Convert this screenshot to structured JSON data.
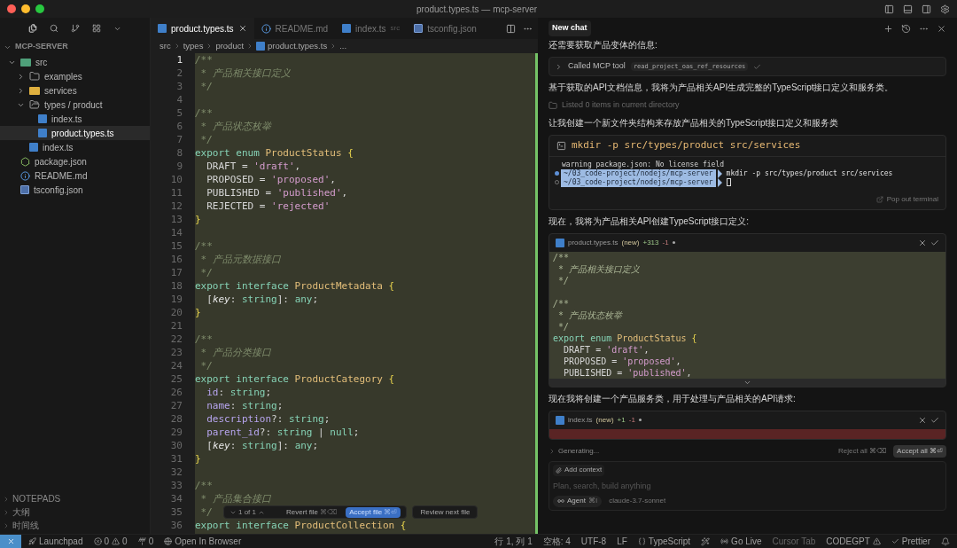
{
  "window": {
    "title": "product.types.ts — mcp-server"
  },
  "sidebar": {
    "title": "MCP-SERVER",
    "tree": [
      {
        "label": "src",
        "kind": "src-folder",
        "expanded": true,
        "selected": false,
        "children": [
          {
            "label": "examples",
            "kind": "folder",
            "expanded": false,
            "selected": false
          },
          {
            "label": "services",
            "kind": "folder-services",
            "expanded": false,
            "selected": false
          },
          {
            "label": "types / product",
            "kind": "folder",
            "expanded": true,
            "selected": false,
            "children": [
              {
                "label": "index.ts",
                "kind": "ts",
                "selected": false
              },
              {
                "label": "product.types.ts",
                "kind": "ts",
                "selected": true
              }
            ]
          },
          {
            "label": "index.ts",
            "kind": "ts",
            "selected": false
          }
        ]
      },
      {
        "label": "package.json",
        "kind": "node",
        "selected": false
      },
      {
        "label": "README.md",
        "kind": "info",
        "selected": false
      },
      {
        "label": "tsconfig.json",
        "kind": "tsconfig",
        "selected": false
      }
    ],
    "sections": [
      {
        "label": "NOTEPADS"
      },
      {
        "label": "大纲"
      },
      {
        "label": "时间线"
      }
    ]
  },
  "tabs": [
    {
      "label": "product.types.ts",
      "kind": "ts",
      "selected": true
    },
    {
      "label": "README.md",
      "kind": "info",
      "selected": false
    },
    {
      "label": "index.ts",
      "detail": "src",
      "kind": "ts",
      "selected": false
    },
    {
      "label": "tsconfig.json",
      "kind": "tsconfig",
      "selected": false
    }
  ],
  "breadcrumb": [
    "src",
    "types",
    "product",
    "product.types.ts",
    "..."
  ],
  "editor": {
    "kind": "added",
    "lines": [
      {
        "n": "1",
        "tokens": [
          {
            "kind": "comment",
            "t": "/**"
          }
        ]
      },
      {
        "n": "2",
        "tokens": [
          {
            "kind": "comment",
            "t": " * 产品相关接口定义"
          }
        ]
      },
      {
        "n": "3",
        "tokens": [
          {
            "kind": "comment",
            "t": " */"
          }
        ]
      },
      {
        "n": "4"
      },
      {
        "n": "5",
        "tokens": [
          {
            "kind": "comment",
            "t": "/**"
          }
        ]
      },
      {
        "n": "6",
        "tokens": [
          {
            "kind": "comment",
            "t": " * 产品状态枚举"
          }
        ]
      },
      {
        "n": "7",
        "tokens": [
          {
            "kind": "comment",
            "t": " */"
          }
        ]
      },
      {
        "n": "8",
        "tokens": [
          {
            "kind": "kw",
            "t": "export enum "
          },
          {
            "kind": "type",
            "t": "ProductStatus "
          },
          {
            "kind": "brace",
            "t": "{"
          }
        ]
      },
      {
        "n": "9",
        "tokens": [
          {
            "kind": "plain",
            "t": "  DRAFT = "
          },
          {
            "kind": "str",
            "t": "'draft'"
          },
          {
            "kind": "plain",
            "t": ","
          }
        ]
      },
      {
        "n": "10",
        "tokens": [
          {
            "kind": "plain",
            "t": "  PROPOSED = "
          },
          {
            "kind": "str",
            "t": "'proposed'"
          },
          {
            "kind": "plain",
            "t": ","
          }
        ]
      },
      {
        "n": "11",
        "tokens": [
          {
            "kind": "plain",
            "t": "  PUBLISHED = "
          },
          {
            "kind": "str",
            "t": "'published'"
          },
          {
            "kind": "plain",
            "t": ","
          }
        ]
      },
      {
        "n": "12",
        "tokens": [
          {
            "kind": "plain",
            "t": "  REJECTED = "
          },
          {
            "kind": "str",
            "t": "'rejected'"
          }
        ]
      },
      {
        "n": "13",
        "tokens": [
          {
            "kind": "brace",
            "t": "}"
          }
        ]
      },
      {
        "n": "14"
      },
      {
        "n": "15",
        "tokens": [
          {
            "kind": "comment",
            "t": "/**"
          }
        ]
      },
      {
        "n": "16",
        "tokens": [
          {
            "kind": "comment",
            "t": " * 产品元数据接口"
          }
        ]
      },
      {
        "n": "17",
        "tokens": [
          {
            "kind": "comment",
            "t": " */"
          }
        ]
      },
      {
        "n": "18",
        "tokens": [
          {
            "kind": "kw",
            "t": "export interface "
          },
          {
            "kind": "type",
            "t": "ProductMetadata "
          },
          {
            "kind": "brace",
            "t": "{"
          }
        ]
      },
      {
        "n": "19",
        "tokens": [
          {
            "kind": "plain",
            "t": "  ["
          },
          {
            "kind": "key",
            "t": "key"
          },
          {
            "kind": "plain",
            "t": ": "
          },
          {
            "kind": "kw",
            "t": "string"
          },
          {
            "kind": "plain",
            "t": "]: "
          },
          {
            "kind": "kw",
            "t": "any"
          },
          {
            "kind": "plain",
            "t": ";"
          }
        ]
      },
      {
        "n": "20",
        "tokens": [
          {
            "kind": "brace",
            "t": "}"
          }
        ]
      },
      {
        "n": "21"
      },
      {
        "n": "22",
        "tokens": [
          {
            "kind": "comment",
            "t": "/**"
          }
        ]
      },
      {
        "n": "23",
        "tokens": [
          {
            "kind": "comment",
            "t": " * 产品分类接口"
          }
        ]
      },
      {
        "n": "24",
        "tokens": [
          {
            "kind": "comment",
            "t": " */"
          }
        ]
      },
      {
        "n": "25",
        "tokens": [
          {
            "kind": "kw",
            "t": "export interface "
          },
          {
            "kind": "type",
            "t": "ProductCategory "
          },
          {
            "kind": "brace",
            "t": "{"
          }
        ]
      },
      {
        "n": "26",
        "tokens": [
          {
            "kind": "prop",
            "t": "  id"
          },
          {
            "kind": "plain",
            "t": ": "
          },
          {
            "kind": "kw",
            "t": "string"
          },
          {
            "kind": "plain",
            "t": ";"
          }
        ]
      },
      {
        "n": "27",
        "tokens": [
          {
            "kind": "prop",
            "t": "  name"
          },
          {
            "kind": "plain",
            "t": ": "
          },
          {
            "kind": "kw",
            "t": "string"
          },
          {
            "kind": "plain",
            "t": ";"
          }
        ]
      },
      {
        "n": "28",
        "tokens": [
          {
            "kind": "prop",
            "t": "  description"
          },
          {
            "kind": "plain",
            "t": "?: "
          },
          {
            "kind": "kw",
            "t": "string"
          },
          {
            "kind": "plain",
            "t": ";"
          }
        ]
      },
      {
        "n": "29",
        "tokens": [
          {
            "kind": "prop",
            "t": "  parent_id"
          },
          {
            "kind": "plain",
            "t": "?: "
          },
          {
            "kind": "kw",
            "t": "string"
          },
          {
            "kind": "plain",
            "t": " | "
          },
          {
            "kind": "kw",
            "t": "null"
          },
          {
            "kind": "plain",
            "t": ";"
          }
        ]
      },
      {
        "n": "30",
        "tokens": [
          {
            "kind": "plain",
            "t": "  ["
          },
          {
            "kind": "key",
            "t": "key"
          },
          {
            "kind": "plain",
            "t": ": "
          },
          {
            "kind": "kw",
            "t": "string"
          },
          {
            "kind": "plain",
            "t": "]: "
          },
          {
            "kind": "kw",
            "t": "any"
          },
          {
            "kind": "plain",
            "t": ";"
          }
        ]
      },
      {
        "n": "31",
        "tokens": [
          {
            "kind": "brace",
            "t": "}"
          }
        ]
      },
      {
        "n": "32"
      },
      {
        "n": "33",
        "tokens": [
          {
            "kind": "comment",
            "t": "/**"
          }
        ]
      },
      {
        "n": "34",
        "tokens": [
          {
            "kind": "comment",
            "t": " * 产品集合接口"
          }
        ]
      },
      {
        "n": "35",
        "tokens": [
          {
            "kind": "comment",
            "t": " */"
          }
        ]
      },
      {
        "n": "36",
        "tokens": [
          {
            "kind": "kw",
            "t": "export interface "
          },
          {
            "kind": "type",
            "t": "ProductCollection "
          },
          {
            "kind": "brace",
            "t": "{"
          }
        ]
      }
    ],
    "review_bar": {
      "counter": "1 of 1",
      "revert": {
        "label": "Revert file",
        "shortcut": "⌘⌫"
      },
      "accept": {
        "label": "Accept file",
        "shortcut": "⌘⏎"
      },
      "next": "Review next file"
    }
  },
  "chat": {
    "tab": "New chat",
    "messages": [
      {
        "kind": "text",
        "text": "还需要获取产品变体的信息:"
      },
      {
        "kind": "tool",
        "label": "Called MCP tool",
        "tool": "read_project_oas_ref_resources",
        "done": true
      },
      {
        "kind": "text",
        "text": "基于获取的API文档信息，我将为产品相关API生成完整的TypeScript接口定义和服务类。"
      },
      {
        "kind": "listed",
        "text": "Listed 0 items in current directory"
      },
      {
        "kind": "text",
        "text": "让我创建一个新文件夹结构来存放产品相关的TypeScript接口定义和服务类"
      },
      {
        "kind": "terminal",
        "command": "mkdir -p src/types/product src/services",
        "output": "warning package.json: No license field",
        "prompts": [
          {
            "path": "~/03_code-project/nodejs/mcp-server",
            "command": "mkdir -p src/types/product src/services",
            "kind": "done"
          },
          {
            "path": "~/03_code-project/nodejs/mcp-server",
            "kind": "running"
          }
        ],
        "popout": "Pop out terminal"
      },
      {
        "kind": "text",
        "text": "现在，我将为产品相关API创建TypeScript接口定义:"
      },
      {
        "kind": "diff",
        "file": "product.types.ts",
        "tag": "(new)",
        "added": "+313",
        "removed": "-1",
        "lines": [
          {
            "kind": "code",
            "tokens": [
              {
                "kind": "comment",
                "t": "/**"
              }
            ]
          },
          {
            "kind": "code",
            "tokens": [
              {
                "kind": "comment",
                "t": " * 产品相关接口定义"
              }
            ]
          },
          {
            "kind": "code",
            "tokens": [
              {
                "kind": "comment",
                "t": " */"
              }
            ]
          },
          {
            "kind": "blank"
          },
          {
            "kind": "code",
            "tokens": [
              {
                "kind": "comment",
                "t": "/**"
              }
            ]
          },
          {
            "kind": "code",
            "tokens": [
              {
                "kind": "comment",
                "t": " * 产品状态枚举"
              }
            ]
          },
          {
            "kind": "code",
            "tokens": [
              {
                "kind": "comment",
                "t": " */"
              }
            ]
          },
          {
            "kind": "code",
            "tokens": [
              {
                "kind": "kw",
                "t": "export enum "
              },
              {
                "kind": "type",
                "t": "ProductStatus "
              },
              {
                "kind": "brace",
                "t": "{"
              }
            ]
          },
          {
            "kind": "code",
            "tokens": [
              {
                "kind": "plain",
                "t": "  DRAFT = "
              },
              {
                "kind": "str",
                "t": "'draft'"
              },
              {
                "kind": "plain",
                "t": ","
              }
            ]
          },
          {
            "kind": "code",
            "tokens": [
              {
                "kind": "plain",
                "t": "  PROPOSED = "
              },
              {
                "kind": "str",
                "t": "'proposed'"
              },
              {
                "kind": "plain",
                "t": ","
              }
            ]
          },
          {
            "kind": "code",
            "tokens": [
              {
                "kind": "plain",
                "t": "  PUBLISHED = "
              },
              {
                "kind": "str",
                "t": "'published'"
              },
              {
                "kind": "plain",
                "t": ","
              }
            ]
          }
        ]
      },
      {
        "kind": "text",
        "text": "现在我将创建一个产品服务类，用于处理与产品相关的API请求:"
      },
      {
        "kind": "diff",
        "file": "index.ts",
        "tag": "(new)",
        "added": "+1",
        "removed": "-1"
      }
    ],
    "generating": "Generating...",
    "reject_all": {
      "label": "Reject all",
      "shortcut": "⌘⌫"
    },
    "accept_all": {
      "label": "Accept all",
      "shortcut": "⌘⏎"
    },
    "add_context": "Add context",
    "input": {
      "placeholder": "Plan, search, build anything"
    },
    "mode": {
      "label": "Agent",
      "shortcut": "⌘I"
    },
    "model": "claude-3.7-sonnet"
  },
  "status_bar": {
    "left": [
      {
        "kind": "launchpad",
        "text": "Launchpad"
      },
      {
        "kind": "problems",
        "errors": "0",
        "warnings": "0"
      },
      {
        "kind": "ports",
        "text": "0"
      },
      {
        "kind": "browser",
        "text": "Open In Browser"
      }
    ],
    "right": [
      {
        "kind": "text",
        "text": "行 1, 列 1"
      },
      {
        "kind": "text",
        "text": "空格: 4"
      },
      {
        "kind": "text",
        "text": "UTF-8"
      },
      {
        "kind": "text",
        "text": "LF"
      },
      {
        "kind": "language",
        "text": "TypeScript"
      },
      {
        "kind": "icon"
      },
      {
        "kind": "golive",
        "text": "Go Live"
      },
      {
        "kind": "dim",
        "text": "Cursor Tab"
      },
      {
        "kind": "codegpt",
        "text": "CODEGPT"
      },
      {
        "kind": "prettier",
        "text": "Prettier"
      },
      {
        "kind": "bell"
      }
    ]
  }
}
